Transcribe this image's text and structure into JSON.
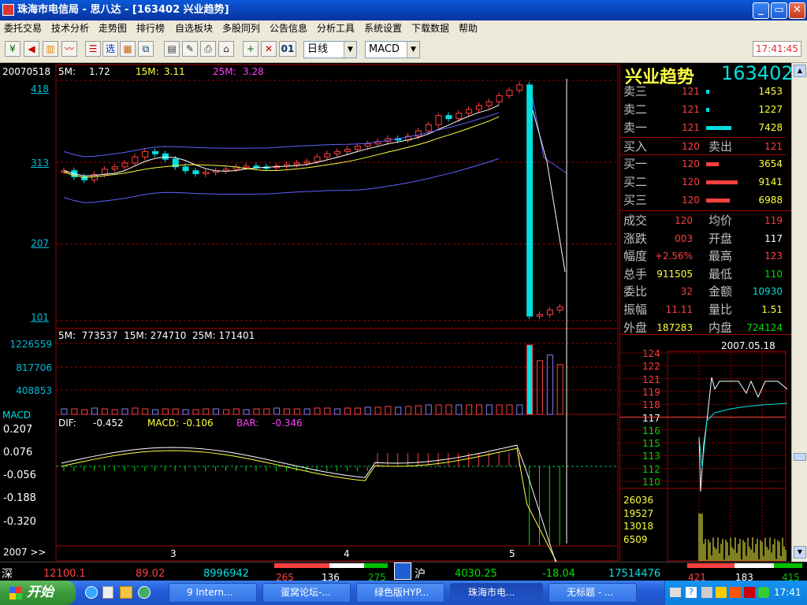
{
  "window": {
    "title": "珠海市电信局 - 思八达 - [163402 兴业趋势]"
  },
  "menu": [
    "委托交易",
    "技术分析",
    "走势图",
    "排行榜",
    "自选板块",
    "多股同列",
    "公告信息",
    "分析工具",
    "系统设置",
    "下载数据",
    "帮助"
  ],
  "toolbar": {
    "period": "日线",
    "indicator": "MACD",
    "time": "17:41:45",
    "icons": [
      "yuan-icon",
      "horn-icon",
      "chart-icon",
      "line-chart-icon",
      "list-icon",
      "select-icon",
      "grid-icon",
      "compare-icon",
      "doc-icon",
      "edit-icon",
      "print-icon",
      "home-icon",
      "plus-icon",
      "cross-icon"
    ],
    "btn_01": "01"
  },
  "kline": {
    "date": "20070518",
    "ma_labels": {
      "ma5": "5M:",
      "ma5_val": "1.72",
      "ma15": "15M:",
      "ma15_val": "3.11",
      "ma25": "25M:",
      "ma25_val": "3.28"
    },
    "y_ticks": [
      "418",
      "313",
      "207",
      "101"
    ]
  },
  "volume": {
    "ma_line": "5M:  773537  15M: 274710  25M: 171401",
    "y_ticks": [
      "1226559",
      "817706",
      "408853"
    ]
  },
  "macd": {
    "label": "MACD",
    "dif": "DIF:",
    "dif_val": "-0.452",
    "macd": "MACD:",
    "macd_val": "-0.106",
    "bar": "BAR:",
    "bar_val": "-0.346",
    "y_ticks": [
      "0.207",
      "0.076",
      "-0.056",
      "-0.188",
      "-0.320"
    ]
  },
  "x_axis": {
    "year": "2007 >>",
    "months": [
      "3",
      "4",
      "5"
    ]
  },
  "right_panel": {
    "name": "兴业趋势",
    "code": "163402",
    "asks": [
      {
        "label": "卖三",
        "price": "121",
        "vol": "1453"
      },
      {
        "label": "卖二",
        "price": "121",
        "vol": "1227"
      },
      {
        "label": "卖一",
        "price": "121",
        "vol": "7428"
      }
    ],
    "buy_sell": {
      "buy_label": "买入",
      "buy": "120",
      "sell_label": "卖出",
      "sell": "121"
    },
    "bids": [
      {
        "label": "买一",
        "price": "120",
        "vol": "3654"
      },
      {
        "label": "买二",
        "price": "120",
        "vol": "9141"
      },
      {
        "label": "买三",
        "price": "120",
        "vol": "6988"
      }
    ],
    "stats": [
      {
        "l1": "成交",
        "v1": "120",
        "l2": "均价",
        "v2": "119"
      },
      {
        "l1": "涨跌",
        "v1": "003",
        "l2": "开盘",
        "v2": "117"
      },
      {
        "l1": "幅度",
        "v1": "+2.56%",
        "l2": "最高",
        "v2": "123"
      },
      {
        "l1": "总手",
        "v1": "911505",
        "l2": "最低",
        "v2": "110"
      },
      {
        "l1": "委比",
        "v1": "32",
        "l2": "金额",
        "v2": "10930"
      },
      {
        "l1": "振幅",
        "v1": "11.11",
        "l2": "量比",
        "v2": "1.51"
      },
      {
        "l1": "外盘",
        "v1": "187283",
        "l2": "内盘",
        "v2": "724124"
      }
    ],
    "intraday": {
      "date": "2007.05.18",
      "price_ticks": [
        "124",
        "122",
        "121",
        "119",
        "118",
        "117",
        "116",
        "115",
        "113",
        "112",
        "110"
      ],
      "vol_ticks": [
        "26036",
        "19527",
        "13018",
        "6509"
      ]
    }
  },
  "statusbar": {
    "sz_label": "深",
    "sz_index": "12100.1",
    "sz_change": "89.02",
    "sz_amount": "8996942",
    "sz_up": "265",
    "sz_flat": "136",
    "sz_down": "275",
    "sh_label": "沪",
    "sh_index": "4030.25",
    "sh_change": "-18.04",
    "sh_amount": "17514476",
    "sh_up": "421",
    "sh_flat": "183",
    "sh_down": "415"
  },
  "taskbar": {
    "start": "开始",
    "tasks": [
      "9 Intern...",
      "蛋窝论坛-...",
      "绿色版HYP...",
      "珠海市电...",
      "无标题 - ..."
    ],
    "clock": "17:41"
  },
  "colors": {
    "up": "#ff4040",
    "down": "#00e0e0",
    "ma5": "#ffffff",
    "ma15": "#ffff40",
    "ma25": "#ff40ff",
    "grid": "#a00000"
  },
  "chart_data": {
    "type": "candlestick",
    "series": [
      {
        "name": "price",
        "values": [
          300,
          292,
          288,
          295,
          302,
          305,
          310,
          318,
          325,
          322,
          315,
          305,
          300,
          296,
          298,
          300,
          302,
          305,
          306,
          305,
          304,
          306,
          308,
          310,
          312,
          318,
          322,
          325,
          328,
          332,
          335,
          338,
          342,
          340,
          345,
          352,
          360,
          372,
          368,
          375,
          380,
          385,
          390,
          398,
          405,
          412,
          110,
          112,
          118,
          122
        ]
      },
      {
        "name": "volume",
        "values": [
          5,
          5,
          4,
          6,
          5,
          4,
          5,
          6,
          5,
          4,
          5,
          5,
          4,
          4,
          5,
          5,
          4,
          5,
          4,
          5,
          5,
          6,
          5,
          5,
          5,
          6,
          6,
          5,
          6,
          6,
          7,
          7,
          8,
          7,
          8,
          9,
          10,
          12,
          11,
          14,
          16,
          18,
          20,
          22,
          26,
          30,
          1226559,
          950000,
          1050000,
          880000
        ]
      }
    ]
  }
}
